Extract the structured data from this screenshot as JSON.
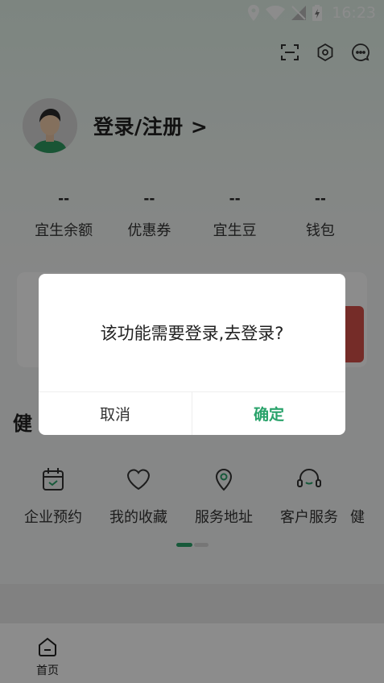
{
  "status_bar": {
    "time": "16:23"
  },
  "profile": {
    "login_label": "登录/注册 >"
  },
  "stats": [
    {
      "value": "--",
      "label": "宜生余额"
    },
    {
      "value": "--",
      "label": "优惠券"
    },
    {
      "value": "--",
      "label": "宜生豆"
    },
    {
      "value": "--",
      "label": "钱包"
    }
  ],
  "section": {
    "title_partial": "健"
  },
  "services": [
    {
      "label": "企业预约",
      "icon": "calendar-check-icon"
    },
    {
      "label": "我的收藏",
      "icon": "heart-icon"
    },
    {
      "label": "服务地址",
      "icon": "location-pin-icon"
    },
    {
      "label": "客户服务",
      "icon": "headset-icon"
    },
    {
      "label": "健",
      "icon": "partial-icon"
    }
  ],
  "tabbar": {
    "home_label": "首页"
  },
  "dialog": {
    "message": "该功能需要登录,去登录?",
    "cancel_label": "取消",
    "confirm_label": "确定"
  },
  "colors": {
    "accent": "#2aa36b",
    "overlay": "rgba(0,0,0,0.45)"
  }
}
